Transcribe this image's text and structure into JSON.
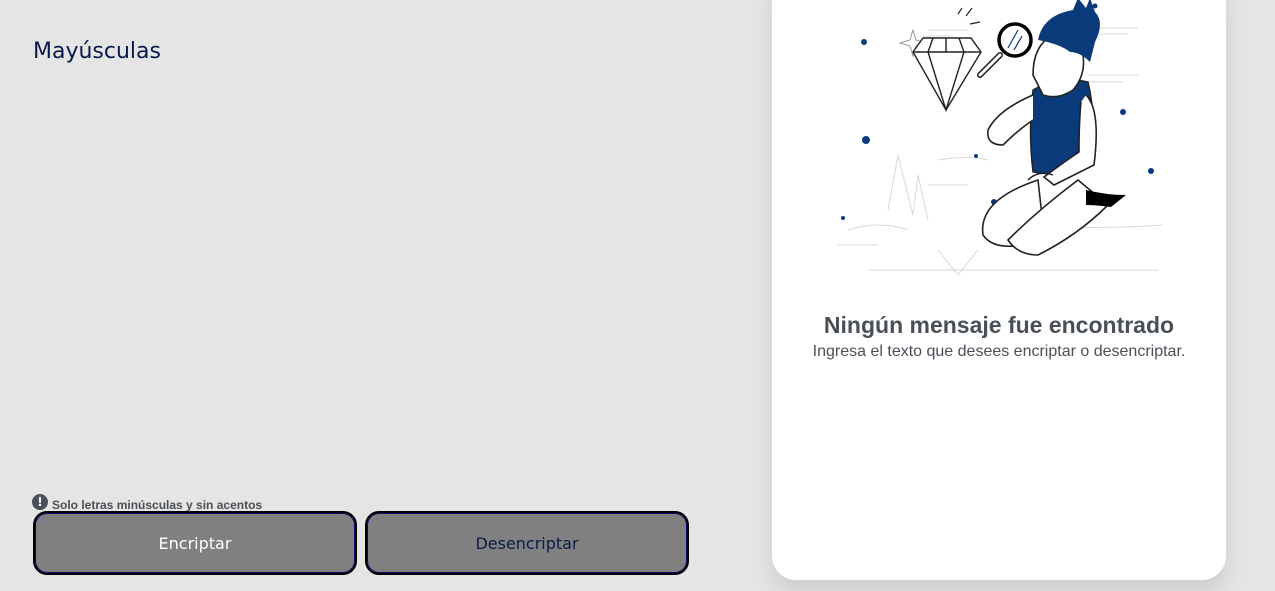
{
  "input": {
    "value": "Mayúsculas"
  },
  "notice": {
    "icon": "exclamation-circle-icon",
    "text": "Solo letras minúsculas y sin acentos"
  },
  "buttons": {
    "encrypt_label": "Encriptar",
    "decrypt_label": "Desencriptar"
  },
  "output": {
    "title": "Ningún mensaje fue encontrado",
    "subtitle": "Ingresa el texto que desees encriptar o desencriptar.",
    "illustration": "person-with-magnifying-glass-diamond-illustration"
  },
  "colors": {
    "background": "#e5e5e5",
    "text_dark_blue": "#0a1a4a",
    "button_gray": "#808080",
    "muted_gray": "#495057",
    "accent_blue": "#0a3a7a"
  }
}
